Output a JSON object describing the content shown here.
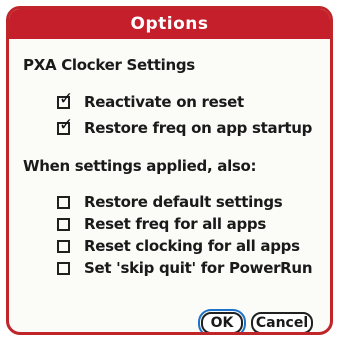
{
  "dialog": {
    "title": "Options"
  },
  "sections": {
    "pxa_title": "PXA Clocker Settings",
    "applied_title": "When settings applied, also:"
  },
  "pxa_options": [
    {
      "label": "Reactivate on reset",
      "checked": true
    },
    {
      "label": "Restore freq on app startup",
      "checked": true
    }
  ],
  "applied_options": [
    {
      "label": "Restore default settings",
      "checked": false
    },
    {
      "label": "Reset freq for all apps",
      "checked": false
    },
    {
      "label": "Reset clocking for all apps",
      "checked": false
    },
    {
      "label": "Set 'skip quit' for PowerRun",
      "checked": false
    }
  ],
  "buttons": {
    "ok_label": "OK",
    "cancel_label": "Cancel"
  },
  "colors": {
    "titlebar": "#c41f2a",
    "border": "#c0252a",
    "focus_ring": "#1d73c9"
  }
}
